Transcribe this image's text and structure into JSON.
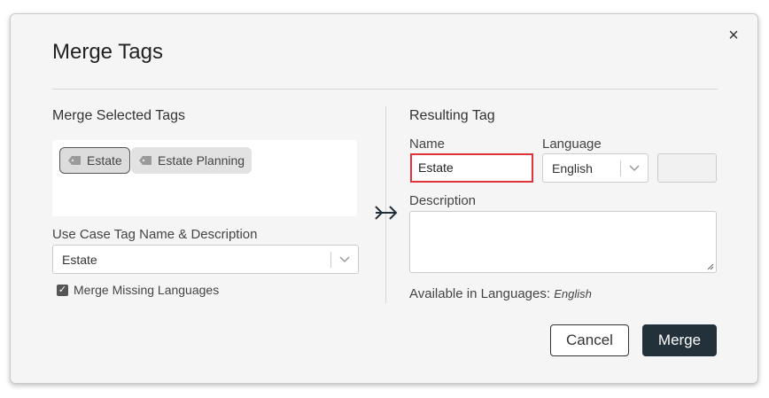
{
  "dialog": {
    "title": "Merge Tags",
    "close_label": "×"
  },
  "left": {
    "section_title": "Merge Selected Tags",
    "tags": [
      {
        "label": "Estate",
        "selected": true
      },
      {
        "label": "Estate Planning",
        "selected": false
      }
    ],
    "use_case_label": "Use Case Tag Name & Description",
    "use_case_value": "Estate",
    "merge_missing_label": "Merge Missing Languages",
    "merge_missing_checked": true
  },
  "right": {
    "section_title": "Resulting Tag",
    "name_label": "Name",
    "name_value": "Estate",
    "language_label": "Language",
    "language_value": "English",
    "description_label": "Description",
    "description_value": "",
    "available_label": "Available in Languages:",
    "available_value": "English"
  },
  "buttons": {
    "cancel": "Cancel",
    "merge": "Merge"
  },
  "colors": {
    "accent": "#22313a",
    "error_border": "#e0343a"
  }
}
